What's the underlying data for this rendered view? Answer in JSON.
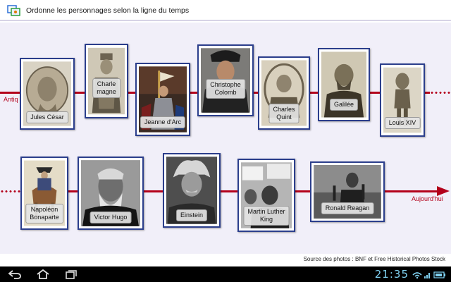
{
  "app": {
    "title": "Ordonne les personnages selon la ligne du temps",
    "icon": "timeline-app-icon"
  },
  "timeline": {
    "start_label": "Antiq",
    "end_label": "Aujourd'hui",
    "color": "#b3001b"
  },
  "cards": [
    {
      "id": "jules-cesar",
      "label": "Jules César"
    },
    {
      "id": "charlemagne",
      "label": "Charle\nmagne"
    },
    {
      "id": "jeanne-darc",
      "label": "Jeanne d'Arc"
    },
    {
      "id": "christophe-colomb",
      "label": "Christophe\nColomb"
    },
    {
      "id": "charles-quint",
      "label": "Charles\nQuint"
    },
    {
      "id": "galilee",
      "label": "Galilée"
    },
    {
      "id": "louis-xiv",
      "label": "Louis XIV"
    },
    {
      "id": "napoleon",
      "label": "Napoléon\nBonaparte"
    },
    {
      "id": "victor-hugo",
      "label": "Victor Hugo"
    },
    {
      "id": "einstein",
      "label": "Einstein"
    },
    {
      "id": "martin-luther-king",
      "label": "Martin Luther\nKing"
    },
    {
      "id": "ronald-reagan",
      "label": "Ronald Reagan"
    }
  ],
  "footer": {
    "source": "Source des photos : BNF et Free Historical Photos Stock"
  },
  "system_bar": {
    "time": "21:35",
    "buttons": [
      "back-icon",
      "home-icon",
      "recent-apps-icon"
    ],
    "status_icons": [
      "wifi-icon",
      "signal-icon",
      "battery-icon"
    ],
    "accent": "#7fd0f0"
  }
}
